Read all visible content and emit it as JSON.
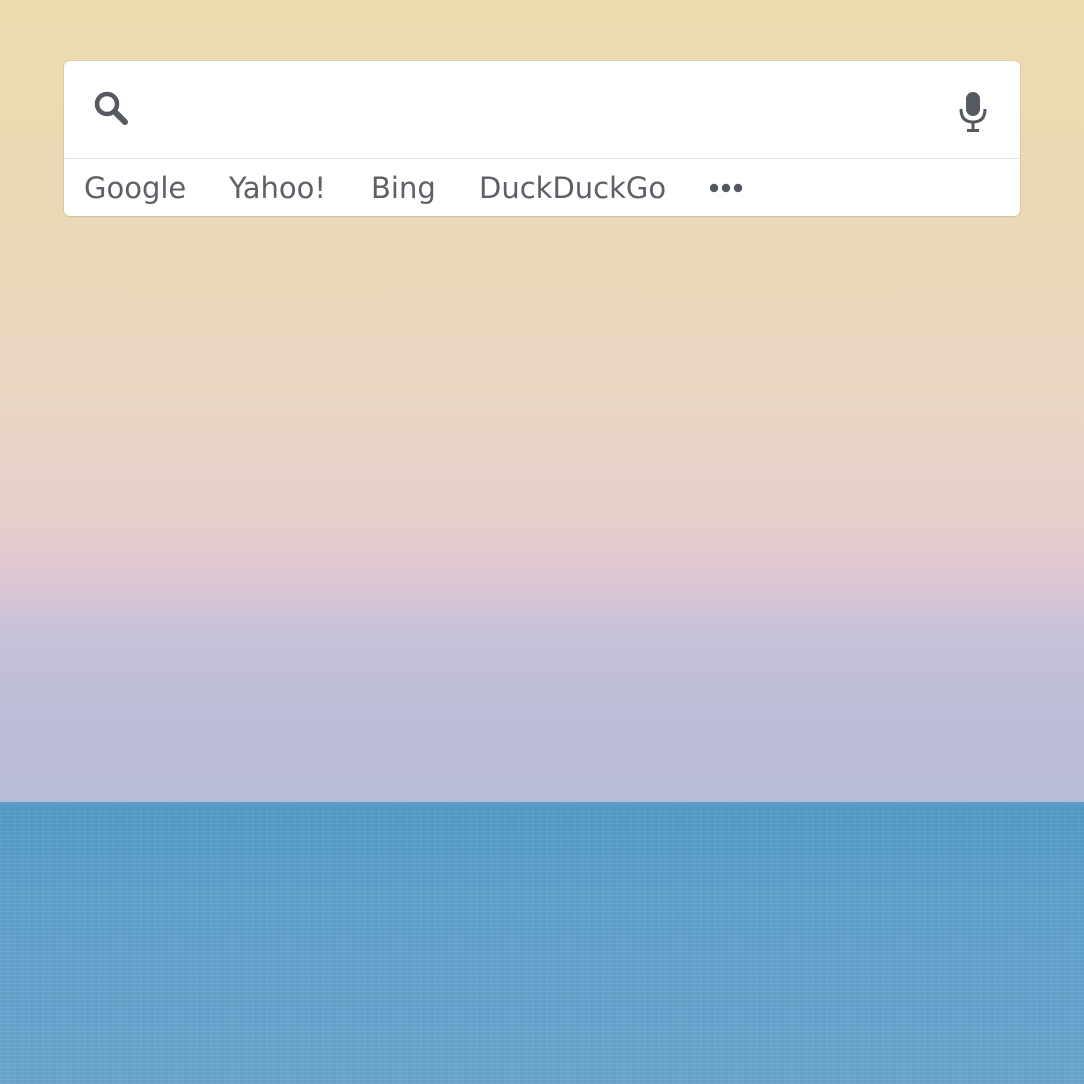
{
  "search": {
    "value": "",
    "placeholder": "",
    "search_icon": "search-icon",
    "mic_icon": "microphone-icon"
  },
  "engines": [
    {
      "label": "Google"
    },
    {
      "label": "Yahoo!"
    },
    {
      "label": "Bing"
    },
    {
      "label": "DuckDuckGo"
    }
  ],
  "more_icon": "more-horizontal-icon",
  "colors": {
    "widget_background": "#ffffff",
    "engine_text": "#5d6066",
    "icon": "#555a60",
    "sea": "#5b9dc8",
    "sky_top": "#ecdcb0",
    "sky_mid": "#e5cfcb",
    "sky_low": "#b8bcd8"
  }
}
